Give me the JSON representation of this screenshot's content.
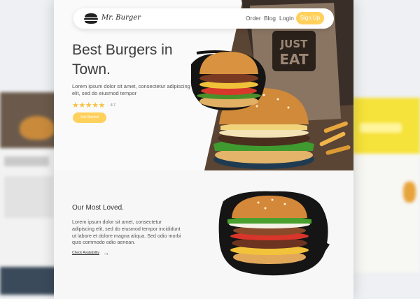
{
  "brand": {
    "name": "Mr. Burger"
  },
  "nav": {
    "links": [
      "Order",
      "Blog",
      "Login"
    ],
    "signup": "Sign Up"
  },
  "hero": {
    "title": "Best Burgers in Town.",
    "description": "Lorem ipsum dolor sit amet, consectetur adipiscing elit, sed do eiusmod tempor",
    "stars": "★★★★★",
    "rating": "4.7",
    "cta": "Get Started",
    "bag_text_1": "JUST",
    "bag_text_2": "EAT"
  },
  "section": {
    "title": "Our Most Loved.",
    "description": "Lorem ipsum dolor sit amet, consectetur adipiscing elit, sed do eiusmod tempor incididunt ut labore et dolore magna aliqua. Sed odio morbi quis commodo odio aenean.",
    "link": "Check Availability",
    "arrow": "→"
  },
  "colors": {
    "accent": "#ffd15c",
    "star": "#f5c242",
    "bag": "#8a7563"
  }
}
